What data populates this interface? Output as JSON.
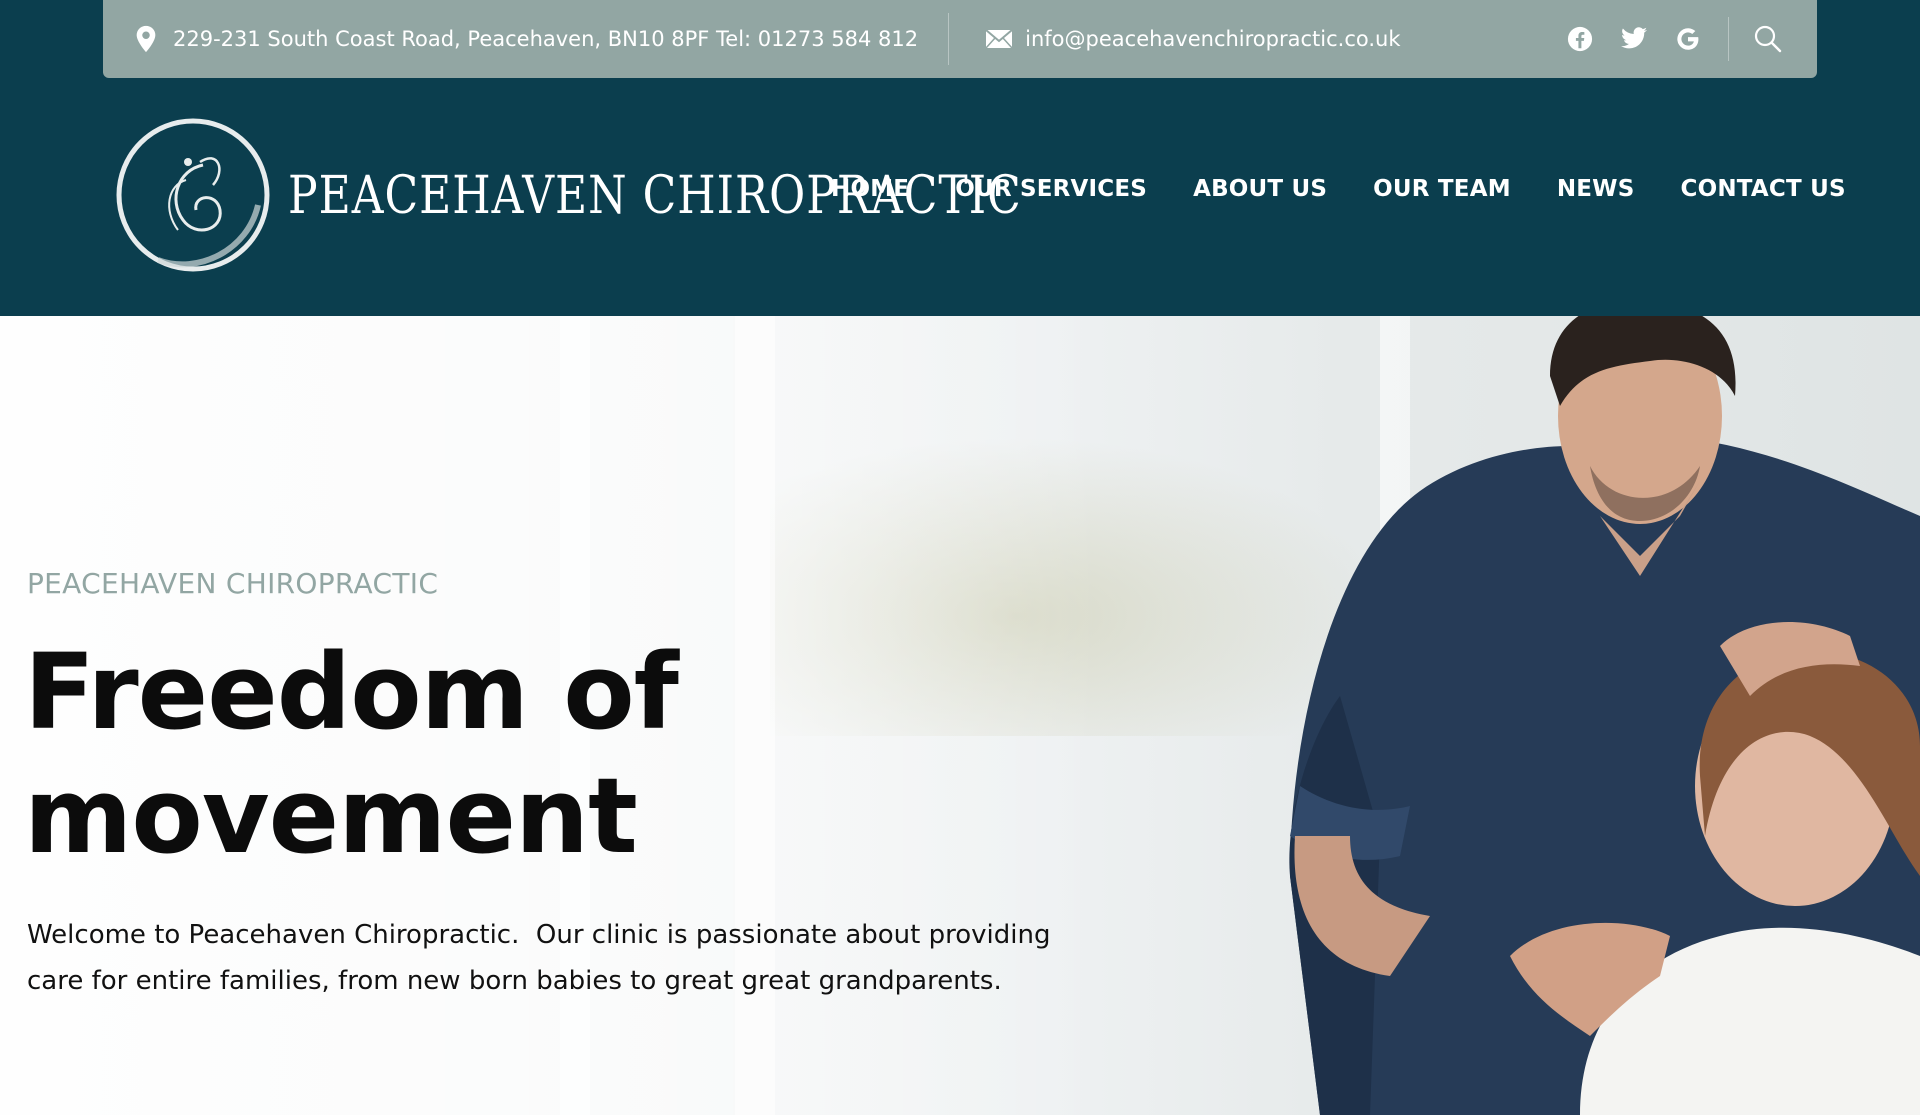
{
  "topbar": {
    "address": "229-231 South Coast Road, Peacehaven, BN10 8PF Tel: 01273 584 812",
    "email": "info@peacehavenchiropractic.co.uk",
    "icons": [
      "map-pin-icon",
      "envelope-icon",
      "facebook-icon",
      "twitter-icon",
      "google-icon",
      "search-icon"
    ]
  },
  "logo": {
    "wordmark": "PEACEHAVEN  CHIROPRACTIC"
  },
  "nav": {
    "items": [
      {
        "label": "HOME"
      },
      {
        "label": "OUR SERVICES"
      },
      {
        "label": "ABOUT US"
      },
      {
        "label": "OUR TEAM"
      },
      {
        "label": "NEWS"
      },
      {
        "label": "CONTACT US"
      }
    ]
  },
  "hero": {
    "eyebrow": "PEACEHAVEN CHIROPRACTIC",
    "headline_line1": "Freedom of",
    "headline_line2": "movement",
    "intro_line1": "Welcome to Peacehaven Chiropractic.  Our clinic is passionate about providing",
    "intro_line2": "care for entire families, from new born babies to great great grandparents."
  },
  "colors": {
    "header_bg": "#0b3e4e",
    "topbar_bg": "#92a6a3",
    "eyebrow": "#92a6a3",
    "scrubs": "#263b57"
  }
}
